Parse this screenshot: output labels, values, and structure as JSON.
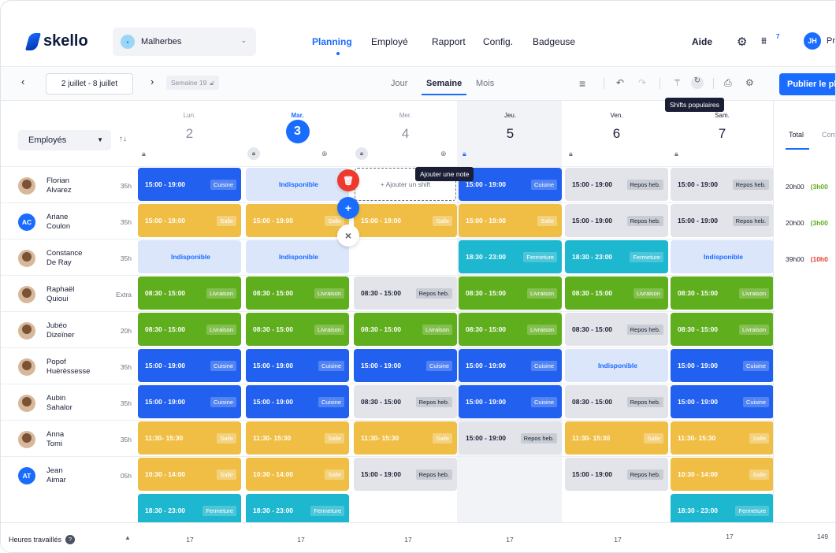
{
  "header": {
    "brand": "skello",
    "venue": "Malherbes",
    "nav": [
      {
        "label": "Planning",
        "active": true
      },
      {
        "label": "Employé",
        "active": false
      },
      {
        "label": "Rapport",
        "active": false
      },
      {
        "label": "Config.",
        "active": false
      },
      {
        "label": "Badgeuse",
        "active": false
      }
    ],
    "help": "Aide",
    "notif_count": "7",
    "user_initials": "JH",
    "user_name": "Pr"
  },
  "toolbar": {
    "date_range": "2 juillet - 8 juillet",
    "week_label": "Semaine 19",
    "views": [
      "Jour",
      "Semaine",
      "Mois"
    ],
    "active_view": "Semaine",
    "publish_label": "Publier le pla",
    "tooltip_popular": "Shifts populaires"
  },
  "grid": {
    "employees_filter": "Employés",
    "days": [
      {
        "name": "Lun.",
        "num": "2"
      },
      {
        "name": "Mar.",
        "num": "3",
        "today": true
      },
      {
        "name": "Mer.",
        "num": "4"
      },
      {
        "name": "Jeu.",
        "num": "5",
        "dark": true
      },
      {
        "name": "Ven.",
        "num": "6",
        "dark": true
      },
      {
        "name": "Sam.",
        "num": "7",
        "dark": true
      }
    ],
    "add_shift_label": "+ Ajouter un shift",
    "tooltip_note": "Ajouter une note",
    "unavailable_label": "Indisponible",
    "employees": [
      {
        "first": "Florian",
        "last": "Alvarez",
        "hours": "35h",
        "avatar": "photo"
      },
      {
        "first": "Ariane",
        "last": "Coulon",
        "hours": "35h",
        "avatar": "AC"
      },
      {
        "first": "Constance",
        "last": "De Ray",
        "hours": "35h",
        "avatar": "photo"
      },
      {
        "first": "Raphaël",
        "last": "Quioui",
        "hours": "Extra",
        "avatar": "photo"
      },
      {
        "first": "Jubéo",
        "last": "Dizeïner",
        "hours": "20h",
        "avatar": "photo"
      },
      {
        "first": "Popof",
        "last": "Huèrèssesse",
        "hours": "35h",
        "avatar": "photo"
      },
      {
        "first": "Aubin",
        "last": "Sahalor",
        "hours": "35h",
        "avatar": "photo"
      },
      {
        "first": "Anna",
        "last": "Tomi",
        "hours": "35h",
        "avatar": "photo"
      },
      {
        "first": "Jean",
        "last": "Aimar",
        "hours": "05h",
        "avatar": "AT"
      }
    ],
    "shifts": [
      {
        "row": 0,
        "day": 0,
        "time": "15:00 - 19:00",
        "tag": "Cuisine",
        "color": "blue"
      },
      {
        "row": 0,
        "day": 1,
        "type": "unavail"
      },
      {
        "row": 0,
        "day": 3,
        "time": "15:00 - 19:00",
        "tag": "Cuisine",
        "color": "blue"
      },
      {
        "row": 0,
        "day": 4,
        "time": "15:00 - 19:00",
        "tag": "Repos heb.",
        "color": "grey"
      },
      {
        "row": 0,
        "day": 5,
        "time": "15:00 - 19:00",
        "tag": "Repos heb.",
        "color": "grey"
      },
      {
        "row": 1,
        "day": 0,
        "time": "15:00 - 19:00",
        "tag": "Salle",
        "color": "yellow"
      },
      {
        "row": 1,
        "day": 1,
        "time": "15:00 - 19:00",
        "tag": "Salle",
        "color": "yellow"
      },
      {
        "row": 1,
        "day": 2,
        "time": "15:00 - 19:00",
        "tag": "Salle",
        "color": "yellow"
      },
      {
        "row": 1,
        "day": 3,
        "time": "15:00 - 19:00",
        "tag": "Salle",
        "color": "yellow"
      },
      {
        "row": 1,
        "day": 4,
        "time": "15:00 - 19:00",
        "tag": "Repos heb.",
        "color": "grey"
      },
      {
        "row": 1,
        "day": 5,
        "time": "15:00 - 19:00",
        "tag": "Repos heb.",
        "color": "grey"
      },
      {
        "row": 2,
        "day": 0,
        "type": "unavail"
      },
      {
        "row": 2,
        "day": 1,
        "type": "unavail"
      },
      {
        "row": 2,
        "day": 3,
        "time": "18:30 - 23:00",
        "tag": "Fermeture",
        "color": "teal"
      },
      {
        "row": 2,
        "day": 4,
        "time": "18:30 - 23:00",
        "tag": "Fermeture",
        "color": "teal"
      },
      {
        "row": 2,
        "day": 5,
        "type": "unavail"
      },
      {
        "row": 3,
        "day": 0,
        "time": "08:30 - 15:00",
        "tag": "Livraison",
        "color": "green"
      },
      {
        "row": 3,
        "day": 1,
        "time": "08:30 - 15:00",
        "tag": "Livraison",
        "color": "green"
      },
      {
        "row": 3,
        "day": 2,
        "time": "08:30 - 15:00",
        "tag": "Repos heb.",
        "color": "grey"
      },
      {
        "row": 3,
        "day": 3,
        "time": "08:30 - 15:00",
        "tag": "Livraison",
        "color": "green"
      },
      {
        "row": 3,
        "day": 4,
        "time": "08:30 - 15:00",
        "tag": "Livraison",
        "color": "green"
      },
      {
        "row": 3,
        "day": 5,
        "time": "08:30 - 15:00",
        "tag": "Livraison",
        "color": "green"
      },
      {
        "row": 4,
        "day": 0,
        "time": "08:30 - 15:00",
        "tag": "Livraison",
        "color": "green"
      },
      {
        "row": 4,
        "day": 1,
        "time": "08:30 - 15:00",
        "tag": "Livraison",
        "color": "green"
      },
      {
        "row": 4,
        "day": 2,
        "time": "08:30 - 15:00",
        "tag": "Livraison",
        "color": "green"
      },
      {
        "row": 4,
        "day": 3,
        "time": "08:30 - 15:00",
        "tag": "Livraison",
        "color": "green"
      },
      {
        "row": 4,
        "day": 4,
        "time": "08:30 - 15:00",
        "tag": "Repos heb.",
        "color": "grey"
      },
      {
        "row": 4,
        "day": 5,
        "time": "08:30 - 15:00",
        "tag": "Livraison",
        "color": "green"
      },
      {
        "row": 5,
        "day": 0,
        "time": "15:00 - 19:00",
        "tag": "Cuisine",
        "color": "blue"
      },
      {
        "row": 5,
        "day": 1,
        "time": "15:00 - 19:00",
        "tag": "Cuisine",
        "color": "blue"
      },
      {
        "row": 5,
        "day": 2,
        "time": "15:00 - 19:00",
        "tag": "Cuisine",
        "color": "blue"
      },
      {
        "row": 5,
        "day": 3,
        "time": "15:00 - 19:00",
        "tag": "Cuisine",
        "color": "blue"
      },
      {
        "row": 5,
        "day": 4,
        "type": "unavail"
      },
      {
        "row": 5,
        "day": 5,
        "time": "15:00 - 19:00",
        "tag": "Cuisine",
        "color": "blue"
      },
      {
        "row": 6,
        "day": 0,
        "time": "15:00 - 19:00",
        "tag": "Cuisine",
        "color": "blue"
      },
      {
        "row": 6,
        "day": 1,
        "time": "15:00 - 19:00",
        "tag": "Cuisine",
        "color": "blue"
      },
      {
        "row": 6,
        "day": 2,
        "time": "08:30 - 15:00",
        "tag": "Repos heb.",
        "color": "grey"
      },
      {
        "row": 6,
        "day": 3,
        "time": "15:00 - 19:00",
        "tag": "Cuisine",
        "color": "blue"
      },
      {
        "row": 6,
        "day": 4,
        "time": "08:30 - 15:00",
        "tag": "Repos heb.",
        "color": "grey"
      },
      {
        "row": 6,
        "day": 5,
        "time": "15:00 - 19:00",
        "tag": "Cuisine",
        "color": "blue"
      },
      {
        "row": 7,
        "day": 0,
        "time": "11:30- 15:30",
        "tag": "Salle",
        "color": "yellow"
      },
      {
        "row": 7,
        "day": 1,
        "time": "11:30- 15:30",
        "tag": "Salle",
        "color": "yellow"
      },
      {
        "row": 7,
        "day": 2,
        "time": "11:30- 15:30",
        "tag": "Salle",
        "color": "yellow"
      },
      {
        "row": 7,
        "day": 3,
        "time": "15:00 - 19:00",
        "tag": "Repos heb.",
        "color": "grey"
      },
      {
        "row": 7,
        "day": 4,
        "time": "11:30- 15:30",
        "tag": "Salle",
        "color": "yellow"
      },
      {
        "row": 7,
        "day": 5,
        "time": "11:30- 15:30",
        "tag": "Salle",
        "color": "yellow"
      },
      {
        "row": 8,
        "day": 0,
        "time": "10:30 - 14:00",
        "tag": "Salle",
        "color": "yellow"
      },
      {
        "row": 8,
        "day": 1,
        "time": "10:30 - 14:00",
        "tag": "Salle",
        "color": "yellow"
      },
      {
        "row": 8,
        "day": 2,
        "time": "15:00 - 19:00",
        "tag": "Repos heb.",
        "color": "grey"
      },
      {
        "row": 8,
        "day": 4,
        "time": "15:00 - 19:00",
        "tag": "Repos heb.",
        "color": "grey"
      },
      {
        "row": 8,
        "day": 5,
        "time": "10:30 - 14:00",
        "tag": "Salle",
        "color": "yellow"
      },
      {
        "row": 9,
        "day": 0,
        "time": "18:30 - 23:00",
        "tag": "Fermeture",
        "color": "teal"
      },
      {
        "row": 9,
        "day": 1,
        "time": "18:30 - 23:00",
        "tag": "Fermeture",
        "color": "teal"
      },
      {
        "row": 9,
        "day": 5,
        "time": "18:30 - 23:00",
        "tag": "Fermeture",
        "color": "teal"
      }
    ]
  },
  "right_panel": {
    "tabs": [
      "Total",
      "Com"
    ],
    "rows": [
      {
        "total": "20h00",
        "diff": "(3h00",
        "diff_color": "green"
      },
      {
        "total": "20h00",
        "diff": "(3h00",
        "diff_color": "green"
      },
      {
        "total": "39h00",
        "diff": "(10h0",
        "diff_color": "red"
      }
    ]
  },
  "footer": {
    "label": "Heures travaillés",
    "values": [
      "17",
      "17",
      "17",
      "17",
      "17",
      "17"
    ],
    "total": "149"
  },
  "colors": {
    "accent": "#1a6cff",
    "cuisine": "#2260f0",
    "salle": "#f0be44",
    "livraison": "#5fae1d",
    "fermeture": "#1db7cf"
  }
}
